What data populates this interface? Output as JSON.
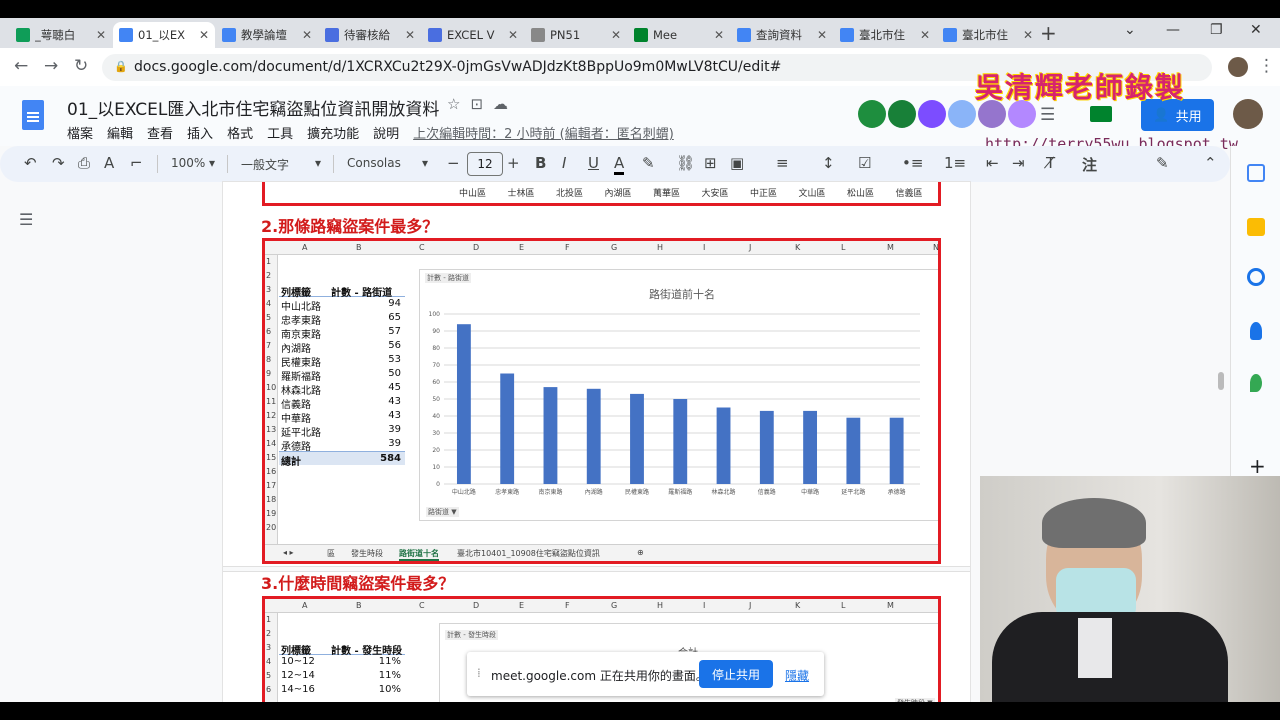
{
  "tabs": [
    {
      "title": "_萼聴白",
      "icon": "google-drive-icon",
      "color": "#0f9d58"
    },
    {
      "title": "01_以EX",
      "icon": "docs-icon",
      "color": "#4285f4",
      "active": true
    },
    {
      "title": "教學論壇",
      "icon": "docs-icon",
      "color": "#4285f4"
    },
    {
      "title": "待審核給",
      "icon": "people-icon",
      "color": "#4a6ee0"
    },
    {
      "title": "EXCEL V",
      "icon": "people-icon",
      "color": "#4a6ee0"
    },
    {
      "title": "PN51",
      "icon": "webpage-icon",
      "color": "#888888"
    },
    {
      "title": "Mee",
      "icon": "meet-icon",
      "color": "#00832d"
    },
    {
      "title": "查詢資料",
      "icon": "apps-script-icon",
      "color": "#4285f4"
    },
    {
      "title": "臺北市住",
      "icon": "apps-script-icon",
      "color": "#4285f4"
    },
    {
      "title": "臺北市住",
      "icon": "apps-script-icon",
      "color": "#4285f4"
    }
  ],
  "address": {
    "url": "docs.google.com/document/d/1XCRXCu2t29X-0jmGsVwADJdzKt8BppUo9m0MwLV8tCU/edit#"
  },
  "overlay": {
    "watermark_url": "http://terry55wu.blogspot.tw",
    "brand": "吳清輝老師錄製"
  },
  "doc": {
    "title": "01_以EXCEL匯入北市住宅竊盜點位資訊開放資料",
    "menu": [
      "檔案",
      "編輯",
      "查看",
      "插入",
      "格式",
      "工具",
      "擴充功能",
      "說明"
    ],
    "last_edit": "上次編輯時間：2 小時前 (編輯者：匿名刺蝟)",
    "share_label": "共用"
  },
  "toolbar": {
    "zoom": "100%",
    "style": "一般文字",
    "font": "Consolas",
    "font_size": "12",
    "input_tools": "注"
  },
  "section1": {
    "districts": [
      "中山區",
      "士林區",
      "北投區",
      "內湖區",
      "萬華區",
      "大安區",
      "中正區",
      "文山區",
      "松山區",
      "信義區"
    ]
  },
  "section2": {
    "heading": "2.那條路竊盜案件最多？",
    "columns": [
      "A",
      "B",
      "C",
      "D",
      "E",
      "F",
      "G",
      "H",
      "I",
      "J",
      "K",
      "L",
      "M",
      "N"
    ],
    "rows": [
      "1",
      "2",
      "3",
      "4",
      "5",
      "6",
      "7",
      "8",
      "9",
      "10",
      "11",
      "12",
      "13",
      "14",
      "15",
      "16",
      "17",
      "18",
      "19",
      "20"
    ],
    "pivot_header": [
      "列標籤",
      "計數 - 路街道"
    ],
    "pivot_rows": [
      {
        "name": "中山北路",
        "value": "94"
      },
      {
        "name": "忠孝東路",
        "value": "65"
      },
      {
        "name": "南京東路",
        "value": "57"
      },
      {
        "name": "內湖路",
        "value": "56"
      },
      {
        "name": "民權東路",
        "value": "53"
      },
      {
        "name": "羅斯福路",
        "value": "50"
      },
      {
        "name": "林森北路",
        "value": "45"
      },
      {
        "name": "信義路",
        "value": "43"
      },
      {
        "name": "中華路",
        "value": "43"
      },
      {
        "name": "延平北路",
        "value": "39"
      },
      {
        "name": "承德路",
        "value": "39"
      }
    ],
    "pivot_total": {
      "name": "總計",
      "value": "584"
    },
    "chart_tag": "計數 - 路街道",
    "filter_tag": "路街道 ▼",
    "sheet_tabs": [
      "區",
      "發生時段",
      "路街道十名",
      "臺北市10401_10908住宅竊盜點位資訊"
    ],
    "active_sheet": "路街道十名"
  },
  "chart_data": {
    "type": "bar",
    "title": "路街道前十名",
    "categories": [
      "中山北路",
      "忠孝東路",
      "南京東路",
      "內湖路",
      "民權東路",
      "羅斯福路",
      "林森北路",
      "信義路",
      "中華路",
      "延平北路",
      "承德路"
    ],
    "values": [
      94,
      65,
      57,
      56,
      53,
      50,
      45,
      43,
      43,
      39,
      39
    ],
    "ylim": [
      0,
      100
    ],
    "yticks": [
      0,
      10,
      20,
      30,
      40,
      50,
      60,
      70,
      80,
      90,
      100
    ],
    "color": "#4472c4",
    "grid": true
  },
  "section3": {
    "heading": "3.什麼時間竊盜案件最多？",
    "columns": [
      "A",
      "B",
      "C",
      "D",
      "E",
      "F",
      "G",
      "H",
      "I",
      "J",
      "K",
      "L",
      "M"
    ],
    "rows": [
      "1",
      "2",
      "3",
      "4",
      "5",
      "6"
    ],
    "pivot_header": [
      "列標籤",
      "計數 - 發生時段"
    ],
    "pivot_rows": [
      {
        "name": "10~12",
        "value": "11%"
      },
      {
        "name": "12~14",
        "value": "11%"
      },
      {
        "name": "14~16",
        "value": "10%"
      }
    ],
    "chart_tag": "計數 - 發生時段",
    "chart_title": "合計",
    "filter_tag": "發生時段 ▼"
  },
  "share_notice": {
    "text": "meet.google.com 正在共用你的畫面。",
    "stop_label": "停止共用",
    "hide_label": "隱藏"
  }
}
